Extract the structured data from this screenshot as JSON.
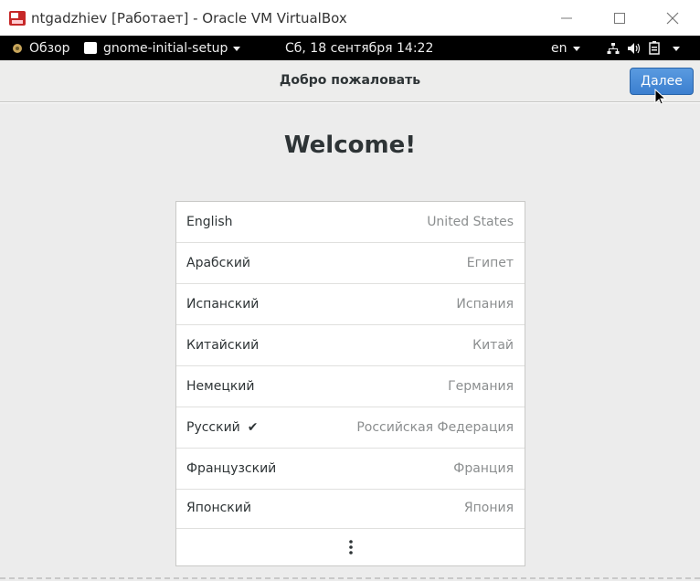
{
  "window": {
    "title": "ntgadzhiev [Работает] - Oracle VM VirtualBox",
    "minimize_glyph": "—",
    "maximize_glyph": "☐",
    "close_glyph": "✕"
  },
  "topbar": {
    "activities": "Обзор",
    "app_menu": "gnome-initial-setup",
    "clock": "Сб, 18 сентября  14:22",
    "input_lang": "en",
    "icons": [
      "network-icon",
      "volume-icon",
      "battery-icon"
    ]
  },
  "header": {
    "title": "Добро пожаловать",
    "next_label": "Далее"
  },
  "main": {
    "heading": "Welcome!",
    "languages": [
      {
        "name": "English",
        "region": "United States",
        "selected": false
      },
      {
        "name": "Арабский",
        "region": "Египет",
        "selected": false
      },
      {
        "name": "Испанский",
        "region": "Испания",
        "selected": false
      },
      {
        "name": "Китайский",
        "region": "Китай",
        "selected": false
      },
      {
        "name": "Немецкий",
        "region": "Германия",
        "selected": false
      },
      {
        "name": "Русский",
        "region": "Российская Федерация",
        "selected": true
      },
      {
        "name": "Французский",
        "region": "Франция",
        "selected": false
      },
      {
        "name": "Японский",
        "region": "Япония",
        "selected": false
      }
    ],
    "check_glyph": "✔",
    "more_icon": "more-vertical-icon"
  },
  "colors": {
    "accent": "#3b7fcf",
    "topbar": "#000000",
    "background": "#ececec"
  }
}
